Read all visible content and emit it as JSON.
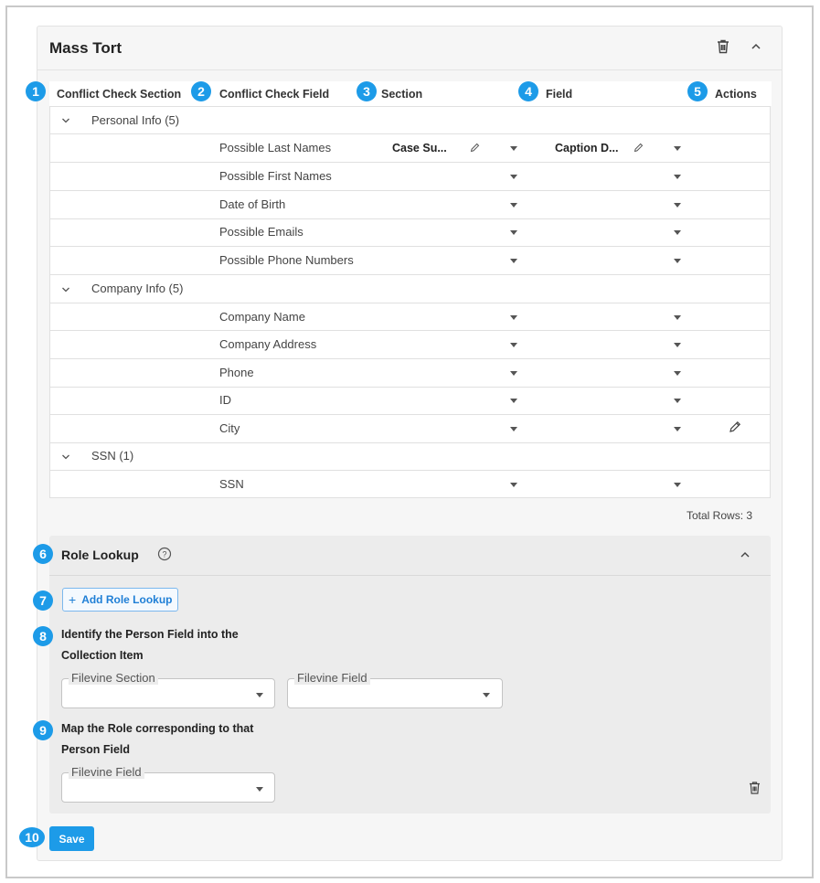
{
  "card": {
    "title": "Mass Tort"
  },
  "badges": [
    "1",
    "2",
    "3",
    "4",
    "5",
    "6",
    "7",
    "8",
    "9",
    "10"
  ],
  "columns": {
    "conflict_section": "Conflict Check Section",
    "conflict_field": "Conflict Check Field",
    "section": "Section",
    "field": "Field",
    "actions": "Actions"
  },
  "groups": [
    {
      "label": "Personal Info (5)",
      "rows": [
        {
          "field": "Possible Last Names",
          "section_value": "Case Su...",
          "field_value": "Caption D..."
        },
        {
          "field": "Possible First Names"
        },
        {
          "field": "Date of Birth"
        },
        {
          "field": "Possible Emails"
        },
        {
          "field": "Possible Phone Numbers"
        }
      ]
    },
    {
      "label": "Company Info (5)",
      "rows": [
        {
          "field": "Company Name"
        },
        {
          "field": "Company Address"
        },
        {
          "field": "Phone"
        },
        {
          "field": "ID"
        },
        {
          "field": "City"
        }
      ]
    },
    {
      "label": "SSN (1)",
      "rows": [
        {
          "field": "SSN"
        }
      ]
    }
  ],
  "total_rows": "Total Rows: 3",
  "role_lookup": {
    "title": "Role Lookup",
    "add_button": "Add Role Lookup",
    "identify_label_line1": "Identify the Person Field into the",
    "identify_label_line2": "Collection Item",
    "section_select_label": "Filevine Section",
    "field_select_label": "Filevine Field",
    "map_label_line1": "Map the Role corresponding to that",
    "map_label_line2": "Person Field",
    "role_field_select_label": "Filevine Field"
  },
  "save_button": "Save",
  "colors": {
    "accent": "#1d9be8",
    "panel": "#ececec",
    "card": "#f6f6f6"
  }
}
